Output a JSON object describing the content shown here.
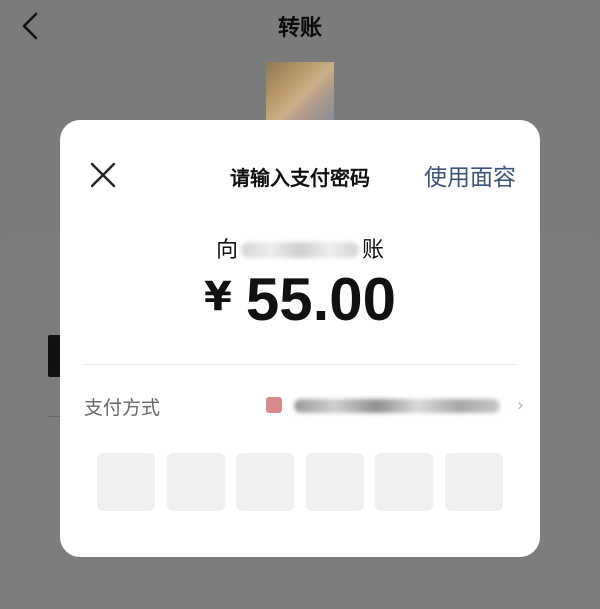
{
  "background_page": {
    "nav_title": "转账"
  },
  "dialog": {
    "title": "请输入支付密码",
    "face_id_label": "使用面容",
    "recipient_prefix": "向",
    "recipient_suffix": "账",
    "currency": "¥",
    "amount": "55.00",
    "payment_method_label": "支付方式",
    "pin_length": 6
  },
  "colors": {
    "overlay": "#7b7b7b",
    "link_blue": "#3d5579",
    "pin_box": "#efefef"
  }
}
